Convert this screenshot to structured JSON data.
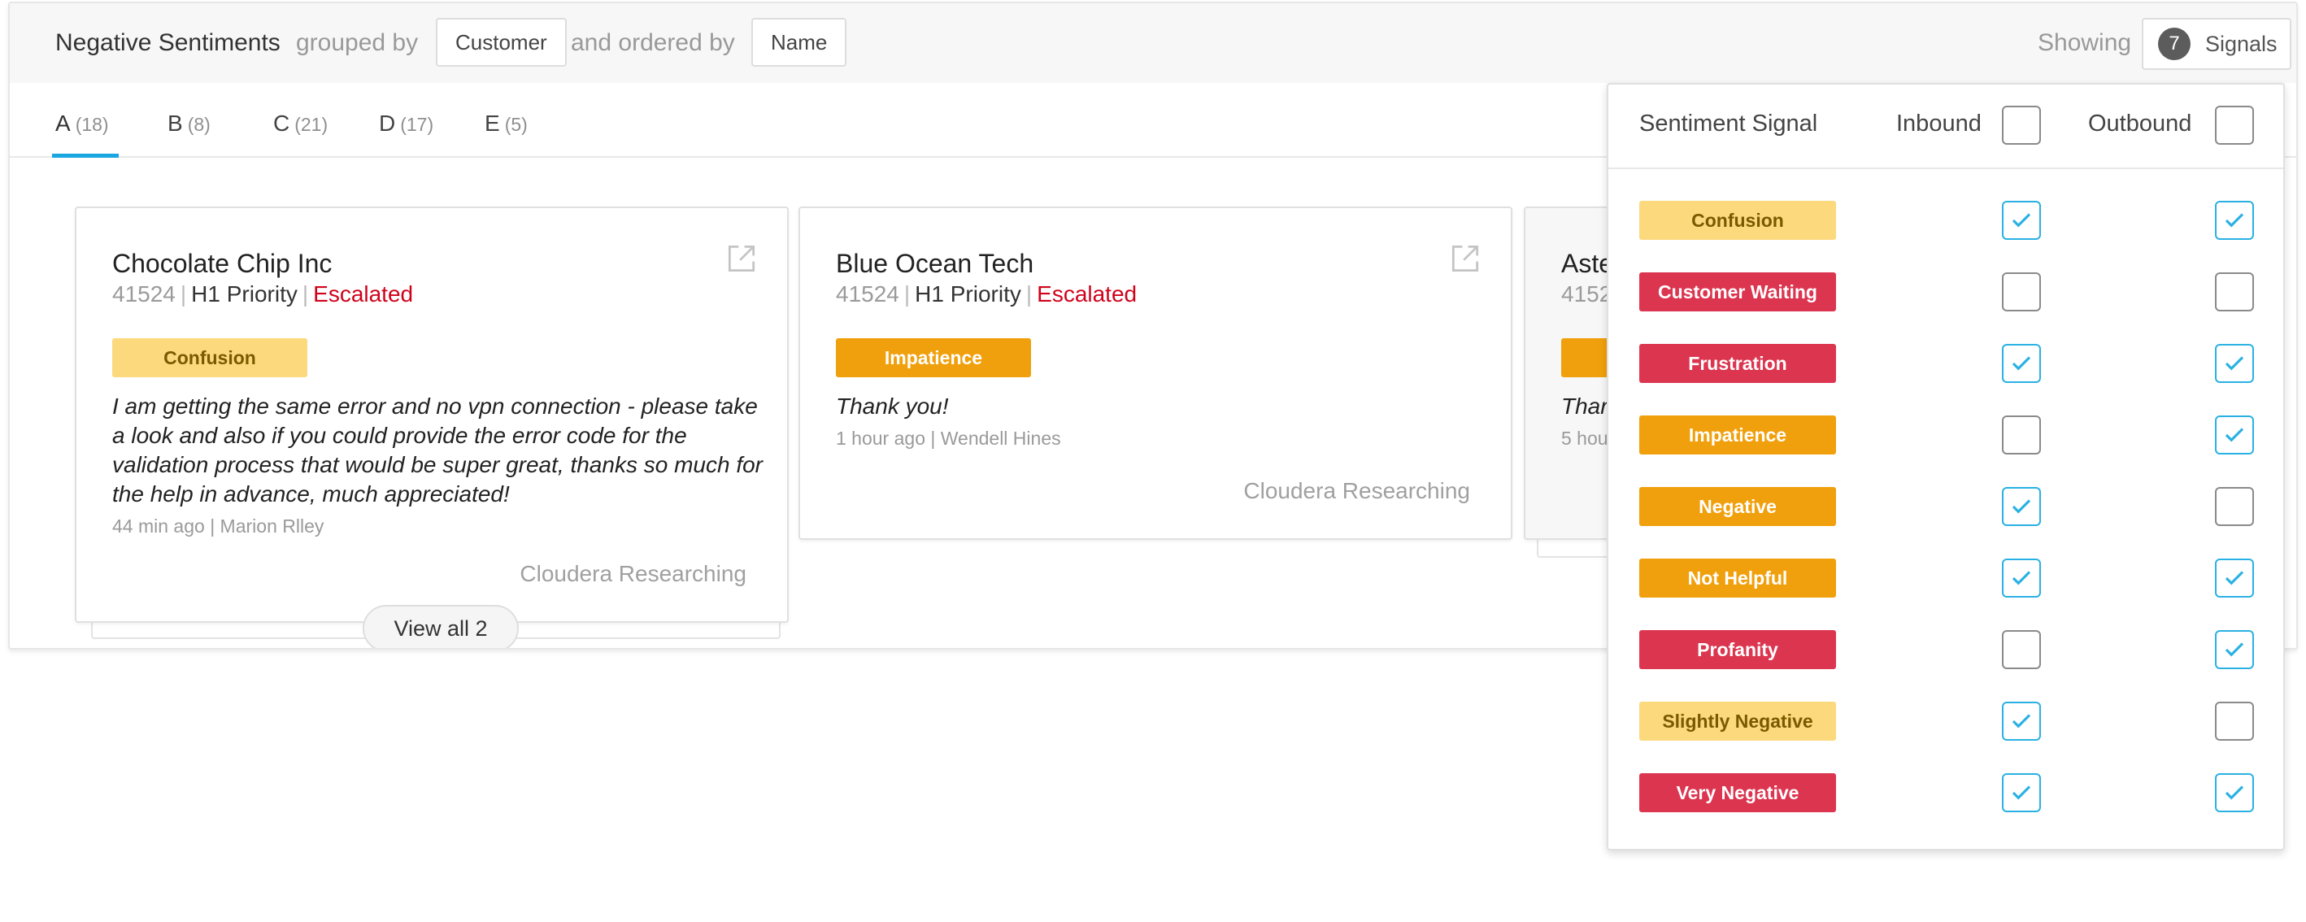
{
  "header": {
    "title": "Negative Sentiments",
    "grouped_by_label": "grouped by",
    "group_value": "Customer",
    "ordered_by_label": "and ordered by",
    "order_value": "Name",
    "showing_label": "Showing",
    "signals_count": "7",
    "signals_label": "Signals"
  },
  "tabs": [
    {
      "label": "A",
      "count": "(18)"
    },
    {
      "label": "B",
      "count": "(8)"
    },
    {
      "label": "C",
      "count": "(21)"
    },
    {
      "label": "D",
      "count": "(17)"
    },
    {
      "label": "E",
      "count": "(5)"
    }
  ],
  "cards": [
    {
      "title": "Chocolate Chip Inc",
      "id": "41524",
      "priority": "H1 Priority",
      "status": "Escalated",
      "tag": "Confusion",
      "message": "I am getting the same error and no vpn connection - please take a look and also if you could provide the error code for the validation process that would be super great, thanks so much for the help in advance, much appreciated!",
      "time": "44 min ago | Marion Rlley",
      "org": "Cloudera Researching",
      "view_all": "View all 2"
    },
    {
      "title": "Blue Ocean Tech",
      "id": "41524",
      "priority": "H1 Priority",
      "status": "Escalated",
      "tag": "Impatience",
      "message": "Thank you!",
      "time": "1 hour ago | Wendell Hines",
      "org": "Cloudera Researching"
    },
    {
      "title": "Aste",
      "id": "4152",
      "message": "Thar",
      "time": "5 hou"
    }
  ],
  "dropdown": {
    "col_signal": "Sentiment Signal",
    "col_inbound": "Inbound",
    "col_outbound": "Outbound",
    "rows": [
      {
        "label": "Confusion",
        "color": "#fcd97d",
        "text_color": "#7a5a00",
        "inbound": true,
        "outbound": true
      },
      {
        "label": "Customer Waiting",
        "color": "#dc3550",
        "text_color": "#ffffff",
        "inbound": false,
        "outbound": false
      },
      {
        "label": "Frustration",
        "color": "#dc3550",
        "text_color": "#ffffff",
        "inbound": true,
        "outbound": true
      },
      {
        "label": "Impatience",
        "color": "#f0a00c",
        "text_color": "#ffffff",
        "inbound": false,
        "outbound": true
      },
      {
        "label": "Negative",
        "color": "#f0a00c",
        "text_color": "#ffffff",
        "inbound": true,
        "outbound": false
      },
      {
        "label": "Not Helpful",
        "color": "#f0a00c",
        "text_color": "#ffffff",
        "inbound": true,
        "outbound": true
      },
      {
        "label": "Profanity",
        "color": "#dc3550",
        "text_color": "#ffffff",
        "inbound": false,
        "outbound": true
      },
      {
        "label": "Slightly Negative",
        "color": "#fcd97d",
        "text_color": "#7a5a00",
        "inbound": true,
        "outbound": false
      },
      {
        "label": "Very Negative",
        "color": "#dc3550",
        "text_color": "#ffffff",
        "inbound": true,
        "outbound": true
      }
    ]
  },
  "colors": {
    "accent": "#1aa6e0",
    "checkbox_checked": "#2ab1e3",
    "escalated": "#d0021b",
    "confusion": "#fcd97d",
    "impatience": "#f0a00c"
  }
}
